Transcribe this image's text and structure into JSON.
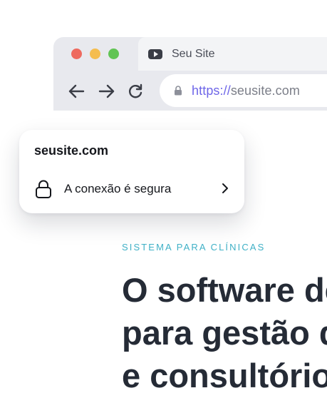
{
  "browser": {
    "tab": {
      "title": "Seu Site",
      "icon": "video-play-icon"
    },
    "window_controls": {
      "close": "#ee6a5f",
      "minimize": "#f5bd4f",
      "maximize": "#61c454"
    },
    "nav": {
      "back_icon": "arrow-left-icon",
      "forward_icon": "arrow-right-icon",
      "reload_icon": "reload-icon"
    },
    "address": {
      "protocol": "https://",
      "domain": "seusite.com",
      "lock_icon": "lock-icon"
    }
  },
  "security_popup": {
    "domain": "seusite.com",
    "status": "A conexão é segura",
    "lock_icon": "lock-icon",
    "chevron_icon": "chevron-right-icon"
  },
  "hero": {
    "eyebrow": "SISTEMA PARA CLÍNICAS",
    "headline": [
      "O software de",
      "para gestão d",
      "e consultórios"
    ]
  },
  "colors": {
    "accent_url": "#6e66e8",
    "eyebrow": "#3fb0c6",
    "headline": "#252b36",
    "chrome": "#e8e9ee"
  }
}
